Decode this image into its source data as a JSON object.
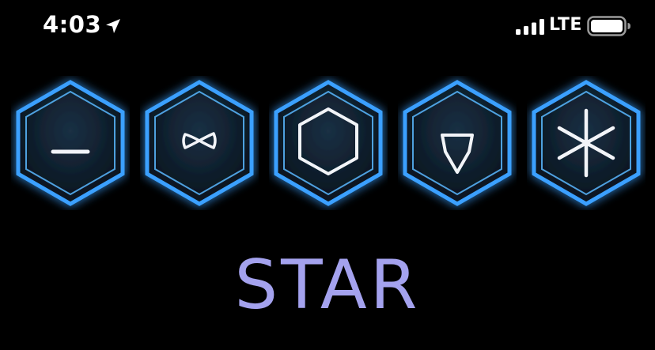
{
  "status_bar": {
    "time": "4:03",
    "network": "LTE",
    "icons": [
      "location-arrow-icon",
      "signal-bars-icon",
      "battery-icon"
    ]
  },
  "tiles": [
    {
      "symbol": "dash-icon"
    },
    {
      "symbol": "infinity-bowtie-icon"
    },
    {
      "symbol": "hexagon-outline-icon"
    },
    {
      "symbol": "shield-icon"
    },
    {
      "symbol": "asterisk-icon"
    }
  ],
  "word": "STAR",
  "colors": {
    "background": "#000000",
    "tile_glow": "#3aa0ff",
    "tile_fill": "#0b1a28",
    "symbol": "#f2f4f8",
    "word": "#a4a2ee"
  }
}
